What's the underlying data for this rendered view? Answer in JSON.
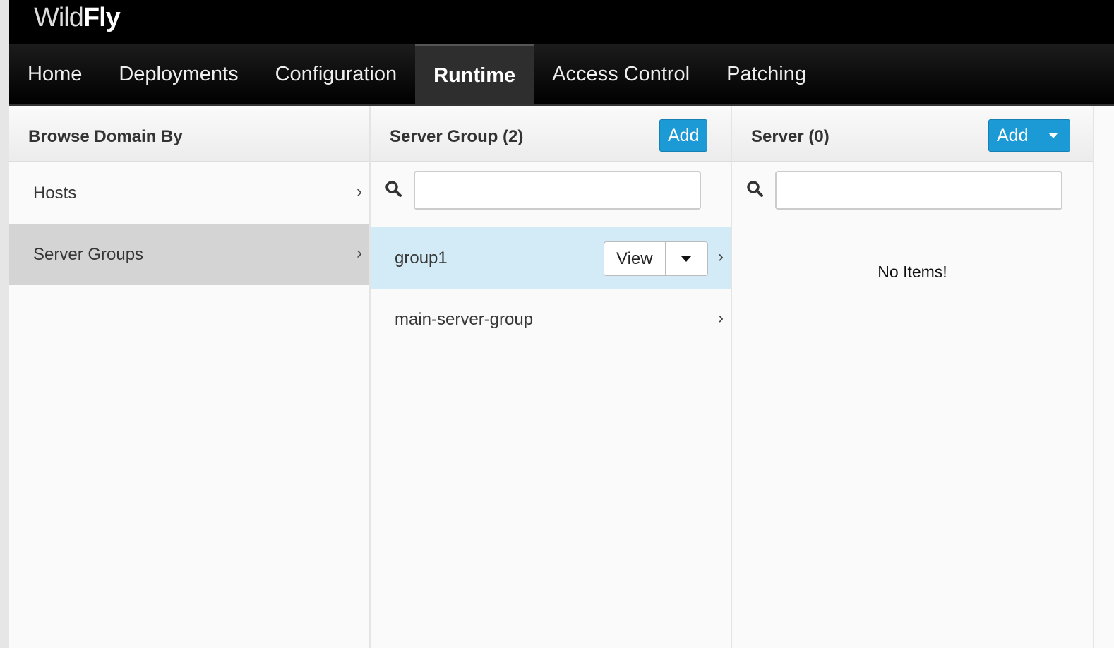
{
  "brand": {
    "light": "Wild",
    "bold": "Fly"
  },
  "nav": [
    "Home",
    "Deployments",
    "Configuration",
    "Runtime",
    "Access Control",
    "Patching"
  ],
  "col1": {
    "title": "Browse Domain By",
    "items": [
      "Hosts",
      "Server Groups"
    ]
  },
  "col2": {
    "title": "Server Group (2)",
    "add": "Add",
    "search_placeholder": "",
    "items": [
      "group1",
      "main-server-group"
    ],
    "view": "View"
  },
  "col3": {
    "title": "Server (0)",
    "add": "Add",
    "search_placeholder": "",
    "empty": "No Items!"
  }
}
